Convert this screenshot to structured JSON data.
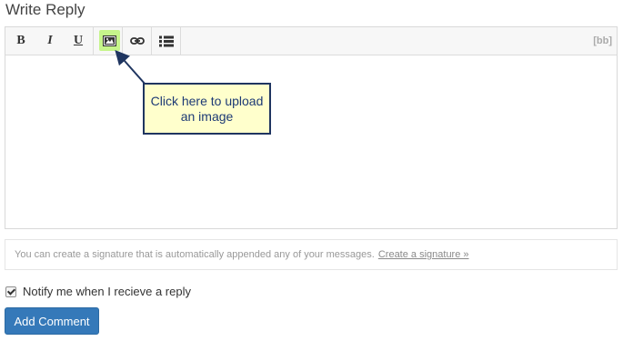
{
  "form": {
    "title": "Write Reply"
  },
  "toolbar": {
    "bold_label": "B",
    "italic_label": "I",
    "underline_label": "U",
    "image_icon": "image-icon",
    "link_icon": "link-icon",
    "list_icon": "list-icon",
    "mode_label": "[bb]",
    "image_highlight_color": "#c6f58b"
  },
  "callout": {
    "text": "Click here to upload an image",
    "background_color": "#ffffcc",
    "border_color": "#1f3560"
  },
  "signature": {
    "text": "You can create a signature that is automatically appended any of your messages.",
    "link_label": "Create a signature »"
  },
  "notify": {
    "label": "Notify me when I recieve a reply",
    "checked": true
  },
  "submit": {
    "label": "Add Comment",
    "color": "#3579b9"
  }
}
